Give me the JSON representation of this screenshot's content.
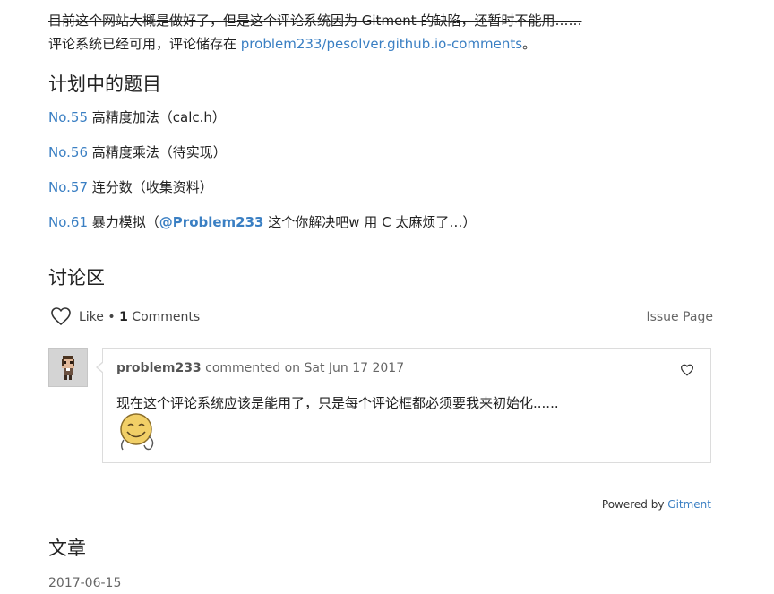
{
  "notice": {
    "strikethrough": "目前这个网站大概是做好了，但是这个评论系统因为 Gitment 的缺陷，还暂时不能用……",
    "line2_prefix": "评论系统已经可用，评论储存在 ",
    "line2_link": "problem233/pesolver.github.io-comments",
    "line2_suffix": "。"
  },
  "plan": {
    "title": "计划中的题目",
    "items": [
      {
        "num": "No.55",
        "text": "高精度加法（calc.h）"
      },
      {
        "num": "No.56",
        "text": "高精度乘法（待实现）"
      },
      {
        "num": "No.57",
        "text": "连分数（收集资料）"
      },
      {
        "num": "No.61",
        "text_before": "暴力模拟（",
        "mention": "@Problem233",
        "text_after": " 这个你解决吧w 用 C 太麻烦了…）"
      }
    ]
  },
  "discussion": {
    "title": "讨论区",
    "like_label": "Like",
    "separator": " • ",
    "comment_count": "1",
    "comments_label": "Comments",
    "issue_page": "Issue Page",
    "comment": {
      "author": "problem233",
      "action": " commented on ",
      "date": "Sat Jun 17 2017",
      "body": "现在这个评论系统应该是能用了，只是每个评论框都必须要我来初始化......"
    },
    "powered_by": "Powered by ",
    "powered_link": "Gitment"
  },
  "articles": {
    "title": "文章",
    "first_date": "2017-06-15"
  },
  "colors": {
    "link": "#3a7fc3",
    "text": "#222222",
    "muted": "#666666",
    "border": "#dcdcdc"
  }
}
